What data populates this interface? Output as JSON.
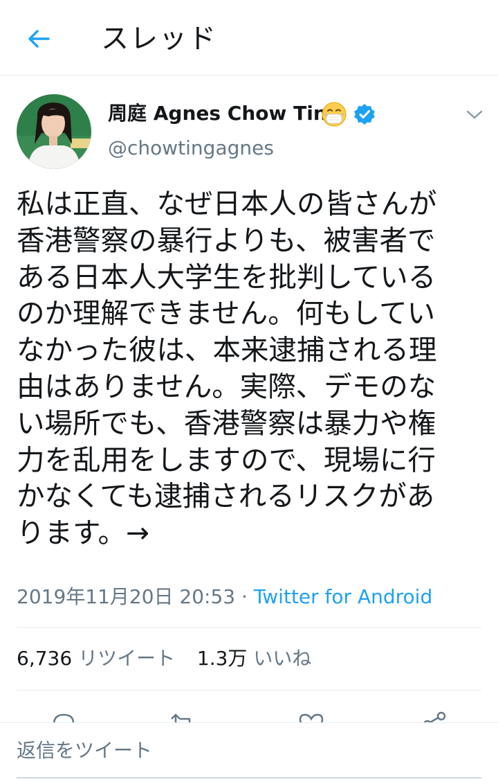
{
  "header": {
    "title": "スレッド",
    "back_icon": "arrow-left-icon",
    "accent_color": "#1da1f2"
  },
  "tweet": {
    "author": {
      "name": "周庭 Agnes Chow Ting",
      "name_emoji": "face-with-medical-mask",
      "verified": true,
      "handle": "@chowtingagnes"
    },
    "text": "私は正直、なぜ日本人の皆さんが\n香港警察の暴行よりも、被害者で\nある日本人大学生を批判している\nのか理解できません。何もしてい\nなかった彼は、本来逮捕される理\n由はありません。実際、デモのな\nい場所でも、香港警察は暴力や権\n力を乱用をしますので、現場に行\nかなくても逮捕されるリスクがあ\nります。→",
    "timestamp": "2019年11月20日 20:53",
    "separator": " · ",
    "source": "Twitter for Android",
    "stats": {
      "retweets_count": "6,736",
      "retweets_label": "リツイート",
      "likes_count": "1.3万",
      "likes_label": "いいね"
    },
    "actions": [
      {
        "name": "reply",
        "icon": "reply-icon"
      },
      {
        "name": "retweet",
        "icon": "retweet-icon"
      },
      {
        "name": "like",
        "icon": "heart-icon"
      },
      {
        "name": "share",
        "icon": "share-icon"
      }
    ]
  },
  "reply": {
    "placeholder": "返信をツイート"
  },
  "colors": {
    "text_primary": "#14171a",
    "text_secondary": "#657786",
    "link": "#1da1f2",
    "divider": "#e6ecf0"
  }
}
